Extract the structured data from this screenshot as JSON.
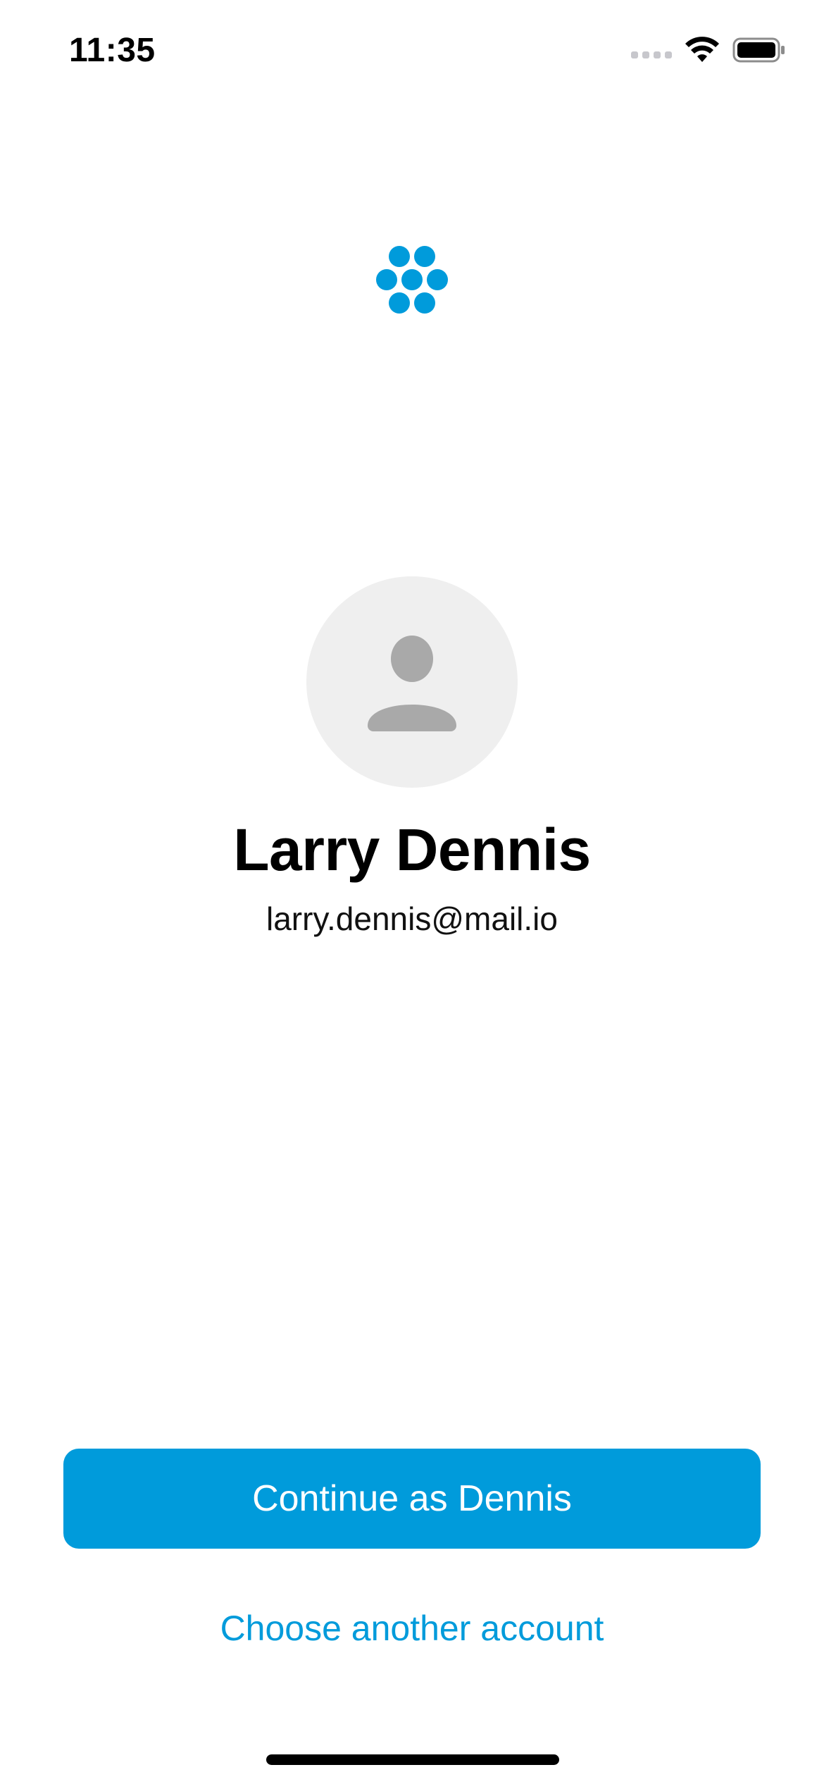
{
  "status_bar": {
    "time": "11:35",
    "signal_icon": "cellular-signal-empty-icon",
    "wifi_icon": "wifi-icon",
    "battery_icon": "battery-full-icon"
  },
  "app": {
    "logo_icon": "blue-dots-logo-icon",
    "accent_color": "#009bdb"
  },
  "account": {
    "avatar_icon": "person-placeholder-icon",
    "name": "Larry Dennis",
    "email": "larry.dennis@mail.io"
  },
  "actions": {
    "continue_label": "Continue as Dennis",
    "choose_another_label": "Choose another account"
  }
}
